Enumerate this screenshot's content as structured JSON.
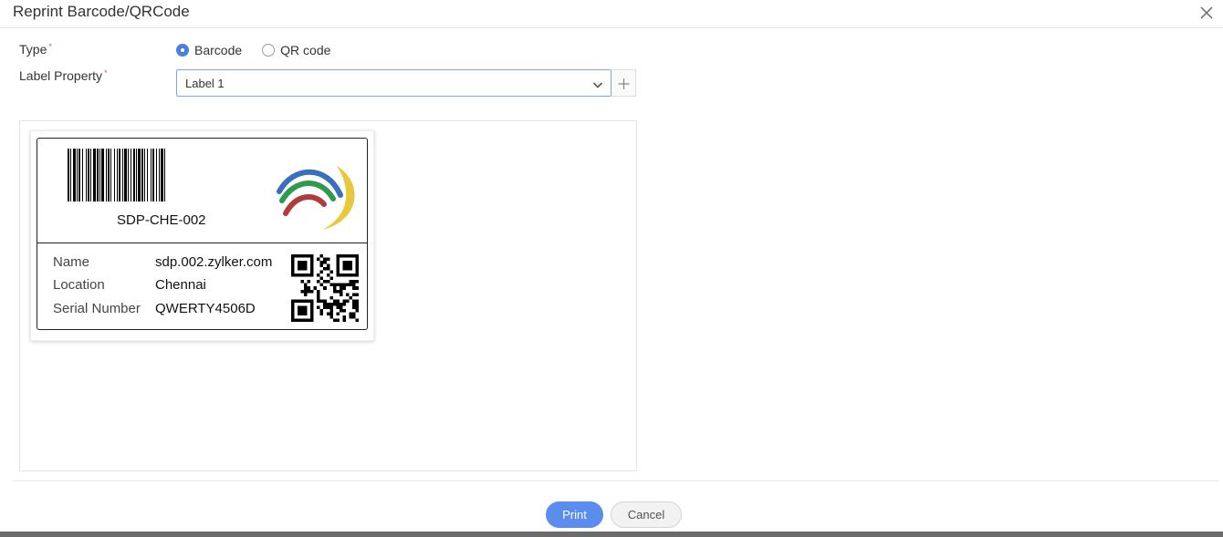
{
  "dialog": {
    "title": "Reprint Barcode/QRCode",
    "close_icon": "close-icon"
  },
  "form": {
    "type_label": "Type",
    "required_mark": "*",
    "type_options": [
      {
        "label": "Barcode",
        "selected": true
      },
      {
        "label": "QR code",
        "selected": false
      }
    ],
    "label_property_label": "Label Property",
    "label_property_value": "Label 1",
    "select_icon": "chevron-down-icon",
    "add_icon": "plus-icon"
  },
  "label_preview": {
    "barcode_text": "SDP-CHE-002",
    "logo_colors": [
      "#3a6fc0",
      "#2e9a4c",
      "#b23a3a",
      "#e8c83c"
    ],
    "fields": [
      {
        "label": "Name",
        "value": "sdp.002.zylker.com"
      },
      {
        "label": "Location",
        "value": "Chennai"
      },
      {
        "label": "Serial Number",
        "value": "QWERTY4506D"
      }
    ]
  },
  "footer": {
    "print_label": "Print",
    "cancel_label": "Cancel"
  },
  "colors": {
    "accent": "#5b8def",
    "required": "#e05252"
  }
}
